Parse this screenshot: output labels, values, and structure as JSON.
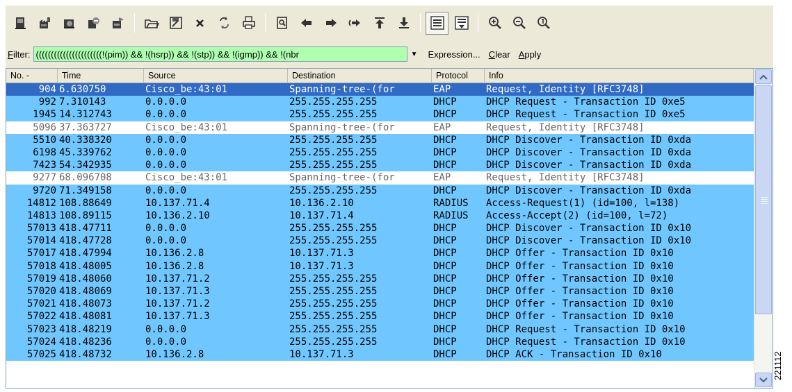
{
  "toolbar": {
    "buttons": [
      {
        "icon": "interfaces-icon"
      },
      {
        "icon": "capture-options-icon"
      },
      {
        "icon": "start-capture-icon"
      },
      {
        "icon": "stop-capture-icon"
      },
      {
        "icon": "restart-capture-icon"
      },
      {
        "icon": "open-file-icon"
      },
      {
        "icon": "save-file-icon"
      },
      {
        "icon": "close-file-icon"
      },
      {
        "icon": "reload-icon"
      },
      {
        "icon": "print-icon"
      },
      {
        "icon": "find-packet-icon"
      },
      {
        "icon": "go-back-icon"
      },
      {
        "icon": "go-forward-icon"
      },
      {
        "icon": "go-to-packet-icon"
      },
      {
        "icon": "go-first-icon"
      },
      {
        "icon": "go-last-icon"
      },
      {
        "icon": "colorize-icon"
      },
      {
        "icon": "auto-scroll-icon"
      },
      {
        "icon": "zoom-in-icon"
      },
      {
        "icon": "zoom-out-icon"
      },
      {
        "icon": "normal-size-icon"
      }
    ],
    "accent_color": "#316ac5"
  },
  "filter": {
    "label": "Filter:",
    "label_mnemonic": "F",
    "label_rest": "ilter:",
    "value": "((((((((((((((((((((((!(pim)) && !(hsrp)) && !(stp)) && !(igmp)) && !(nbr",
    "expression_label": "Expression...",
    "clear_mnemonic": "C",
    "clear_rest": "lear",
    "apply_mnemonic": "A",
    "apply_rest": "pply",
    "input_color": "#afffaf"
  },
  "packet_list": {
    "columns": [
      {
        "label": "No. -"
      },
      {
        "label": "Time"
      },
      {
        "label": "Source"
      },
      {
        "label": "Destination"
      },
      {
        "label": "Protocol"
      },
      {
        "label": "Info"
      }
    ],
    "row_colors": {
      "udp": "#70c7ff",
      "selected": "#316ac5",
      "eap": "#ffffff"
    },
    "rows": [
      {
        "no": "904",
        "time": "6.630750",
        "source": "Cisco_be:43:01",
        "destination": "Spanning-tree-(for",
        "protocol": "EAP",
        "info": "Request, Identity [RFC3748]",
        "style": "sel"
      },
      {
        "no": "992",
        "time": "7.310143",
        "source": "0.0.0.0",
        "destination": "255.255.255.255",
        "protocol": "DHCP",
        "info": "DHCP Request  - Transaction ID 0xe5",
        "style": "udp"
      },
      {
        "no": "1945",
        "time": "14.312743",
        "source": "0.0.0.0",
        "destination": "255.255.255.255",
        "protocol": "DHCP",
        "info": "DHCP Request  - Transaction ID 0xe5",
        "style": "udp"
      },
      {
        "no": "5096",
        "time": "37.363727",
        "source": "Cisco_be:43:01",
        "destination": "Spanning-tree-(for",
        "protocol": "EAP",
        "info": "Request, Identity [RFC3748]",
        "style": "eap"
      },
      {
        "no": "5510",
        "time": "40.338320",
        "source": "0.0.0.0",
        "destination": "255.255.255.255",
        "protocol": "DHCP",
        "info": "DHCP Discover - Transaction ID 0xda",
        "style": "udp"
      },
      {
        "no": "6198",
        "time": "45.339762",
        "source": "0.0.0.0",
        "destination": "255.255.255.255",
        "protocol": "DHCP",
        "info": "DHCP Discover - Transaction ID 0xda",
        "style": "udp"
      },
      {
        "no": "7423",
        "time": "54.342935",
        "source": "0.0.0.0",
        "destination": "255.255.255.255",
        "protocol": "DHCP",
        "info": "DHCP Discover - Transaction ID 0xda",
        "style": "udp"
      },
      {
        "no": "9277",
        "time": "68.096708",
        "source": "Cisco_be:43:01",
        "destination": "Spanning-tree-(for",
        "protocol": "EAP",
        "info": "Request, Identity [RFC3748]",
        "style": "eap"
      },
      {
        "no": "9720",
        "time": "71.349158",
        "source": "0.0.0.0",
        "destination": "255.255.255.255",
        "protocol": "DHCP",
        "info": "DHCP Discover - Transaction ID 0xda",
        "style": "udp"
      },
      {
        "no": "14812",
        "time": "108.88649",
        "source": "10.137.71.4",
        "destination": "10.136.2.10",
        "protocol": "RADIUS",
        "info": "Access-Request(1) (id=100, l=138)",
        "style": "udp"
      },
      {
        "no": "14813",
        "time": "108.89115",
        "source": "10.136.2.10",
        "destination": "10.137.71.4",
        "protocol": "RADIUS",
        "info": "Access-Accept(2) (id=100, l=72)",
        "style": "udp"
      },
      {
        "no": "57013",
        "time": "418.47711",
        "source": "0.0.0.0",
        "destination": "255.255.255.255",
        "protocol": "DHCP",
        "info": "DHCP Discover - Transaction ID 0x10",
        "style": "udp"
      },
      {
        "no": "57014",
        "time": "418.47728",
        "source": "0.0.0.0",
        "destination": "255.255.255.255",
        "protocol": "DHCP",
        "info": "DHCP Discover - Transaction ID 0x10",
        "style": "udp"
      },
      {
        "no": "57017",
        "time": "418.47994",
        "source": "10.136.2.8",
        "destination": "10.137.71.3",
        "protocol": "DHCP",
        "info": "DHCP Offer    - Transaction ID 0x10",
        "style": "udp"
      },
      {
        "no": "57018",
        "time": "418.48005",
        "source": "10.136.2.8",
        "destination": "10.137.71.3",
        "protocol": "DHCP",
        "info": "DHCP Offer    - Transaction ID 0x10",
        "style": "udp"
      },
      {
        "no": "57019",
        "time": "418.48060",
        "source": "10.137.71.2",
        "destination": "255.255.255.255",
        "protocol": "DHCP",
        "info": "DHCP Offer    - Transaction ID 0x10",
        "style": "udp"
      },
      {
        "no": "57020",
        "time": "418.48069",
        "source": "10.137.71.3",
        "destination": "255.255.255.255",
        "protocol": "DHCP",
        "info": "DHCP Offer    - Transaction ID 0x10",
        "style": "udp"
      },
      {
        "no": "57021",
        "time": "418.48073",
        "source": "10.137.71.2",
        "destination": "255.255.255.255",
        "protocol": "DHCP",
        "info": "DHCP Offer    - Transaction ID 0x10",
        "style": "udp"
      },
      {
        "no": "57022",
        "time": "418.48081",
        "source": "10.137.71.3",
        "destination": "255.255.255.255",
        "protocol": "DHCP",
        "info": "DHCP Offer    - Transaction ID 0x10",
        "style": "udp"
      },
      {
        "no": "57023",
        "time": "418.48219",
        "source": "0.0.0.0",
        "destination": "255.255.255.255",
        "protocol": "DHCP",
        "info": "DHCP Request  - Transaction ID 0x10",
        "style": "udp"
      },
      {
        "no": "57024",
        "time": "418.48236",
        "source": "0.0.0.0",
        "destination": "255.255.255.255",
        "protocol": "DHCP",
        "info": "DHCP Request  - Transaction ID 0x10",
        "style": "udp"
      },
      {
        "no": "57025",
        "time": "418.48732",
        "source": "10.136.2.8",
        "destination": "10.137.71.3",
        "protocol": "DHCP",
        "info": "DHCP ACK      - Transaction ID 0x10",
        "style": "udp"
      }
    ]
  },
  "figure_id": "221112"
}
